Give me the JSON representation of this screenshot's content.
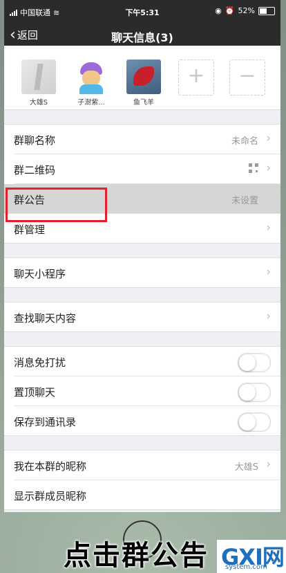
{
  "status_bar": {
    "carrier": "中国联通",
    "time": "下午5:31",
    "battery": "52%"
  },
  "nav": {
    "back_label": "返回",
    "title": "聊天信息(3)"
  },
  "members": [
    {
      "name": "大雄S"
    },
    {
      "name": "子澍紫..."
    },
    {
      "name": "鱼飞羊"
    }
  ],
  "groups": {
    "g1": {
      "group_name_label": "群聊名称",
      "group_name_value": "未命名",
      "qr_label": "群二维码",
      "notice_label": "群公告",
      "notice_value": "未设置",
      "manage_label": "群管理"
    },
    "g2": {
      "mini_program_label": "聊天小程序"
    },
    "g3": {
      "search_label": "查找聊天内容"
    },
    "g4": {
      "mute_label": "消息免打扰",
      "mute_on": false,
      "pin_label": "置顶聊天",
      "pin_on": false,
      "save_label": "保存到通讯录",
      "save_on": false
    },
    "g5": {
      "nickname_label": "我在本群的昵称",
      "nickname_value": "大雄S",
      "show_nick_label": "显示群成员昵称"
    }
  },
  "caption": "点击群公告",
  "watermark": {
    "logo": "GXI网",
    "domain": "system.com"
  },
  "colors": {
    "nav_bg": "#2b2b2b",
    "highlight_border": "#e41e2a",
    "page_bg": "#efeff4"
  }
}
